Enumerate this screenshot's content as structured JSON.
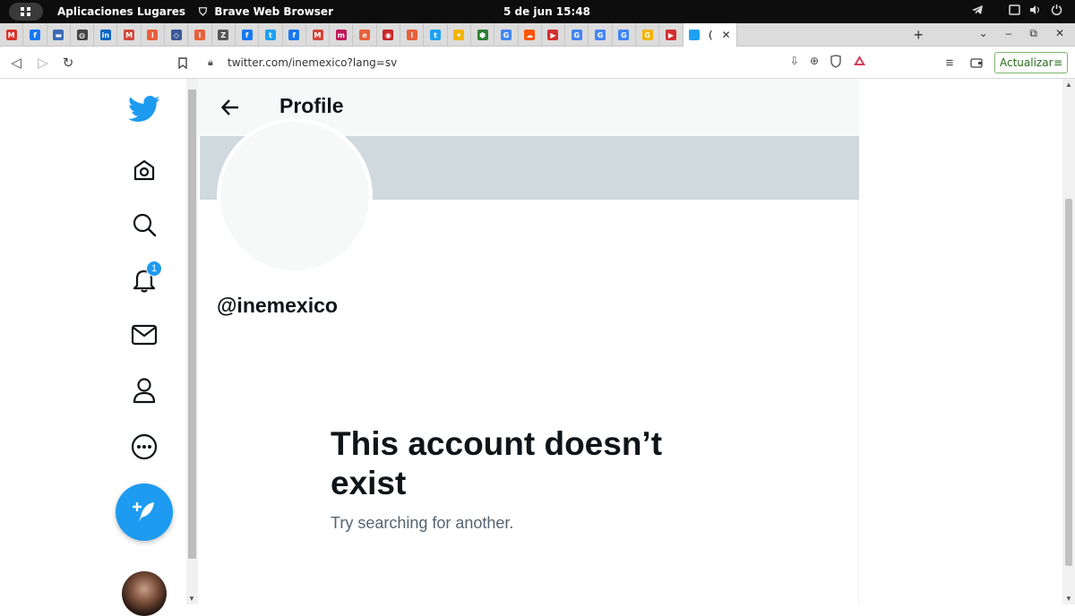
{
  "system": {
    "activities_label": "Aplicaciones",
    "places_label": "Lugares",
    "app_name": "Brave Web Browser",
    "clock": "5 de jun  15:48"
  },
  "browser": {
    "tab_favicon_letters": [
      "M",
      "f",
      "▬",
      "◍",
      "in",
      "M",
      "i",
      "◇",
      "i",
      "Z",
      "f",
      "t",
      "f",
      "M",
      "m",
      "e",
      "◉",
      "i",
      "t",
      "✦",
      "⬢",
      "G",
      "☁",
      "▶",
      "G",
      "G",
      "G",
      "G",
      "▶"
    ],
    "active_tab_text": "(",
    "url": "twitter.com/inemexico?lang=sv",
    "update_label": "Actualizar"
  },
  "twitter": {
    "header_title": "Profile",
    "handle": "@inemexico",
    "notification_count": "1",
    "empty_title": "This account doesn’t exist",
    "empty_subtitle": "Try searching for another.",
    "accent_color": "#1d9bf0"
  }
}
